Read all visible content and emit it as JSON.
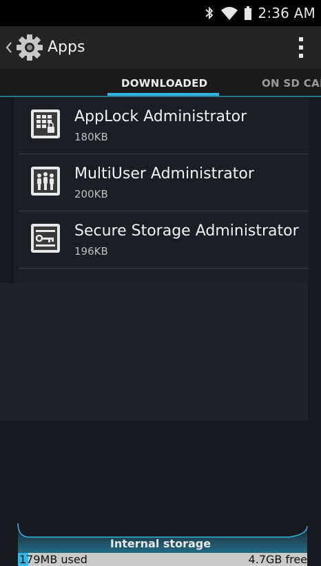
{
  "status_bar": {
    "time": "2:36 AM",
    "icons": [
      "bluetooth-icon",
      "wifi-icon",
      "battery-icon"
    ]
  },
  "action_bar": {
    "title": "Apps",
    "icons": [
      "up-caret-icon",
      "settings-gear-icon",
      "overflow-menu-icon"
    ]
  },
  "tabs": [
    {
      "label": "DOWNLOADED",
      "selected": true
    },
    {
      "label": "ON SD CAR",
      "selected": false
    }
  ],
  "apps": [
    {
      "name": "AppLock Administrator",
      "size": "180KB",
      "icon": "applock-icon"
    },
    {
      "name": "MultiUser Administrator",
      "size": "200KB",
      "icon": "multiuser-icon"
    },
    {
      "name": "Secure Storage Administrator",
      "size": "196KB",
      "icon": "secure-storage-icon"
    }
  ],
  "storage": {
    "label": "Internal storage",
    "used": "179MB used",
    "free": "4.7GB free",
    "used_fraction": 0.036
  },
  "colors": {
    "accent": "#33b5e5",
    "action_bar": "#242424",
    "background": "#16191d"
  }
}
